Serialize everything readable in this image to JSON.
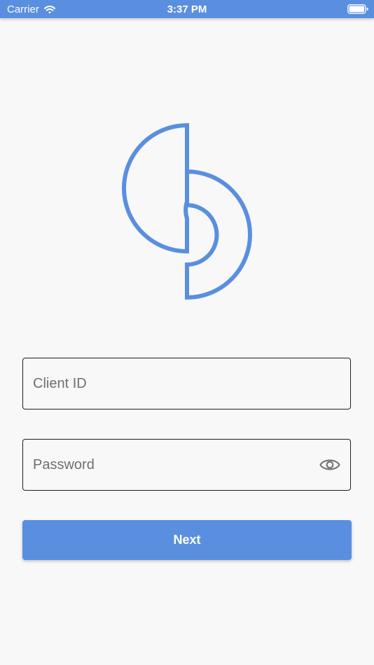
{
  "status_bar": {
    "carrier": "Carrier",
    "time": "3:37 PM",
    "background_color": "#5a8fdf",
    "icons": [
      "wifi-icon",
      "battery-icon"
    ]
  },
  "logo": {
    "icon": "logo-icon",
    "stroke_color": "#5a8fdf"
  },
  "form": {
    "client_id_placeholder": "Client ID",
    "client_id_value": "",
    "password_placeholder": "Password",
    "password_value": "",
    "password_toggle_icon": "eye-icon",
    "next_label": "Next",
    "accent_color": "#5a8fdf"
  }
}
